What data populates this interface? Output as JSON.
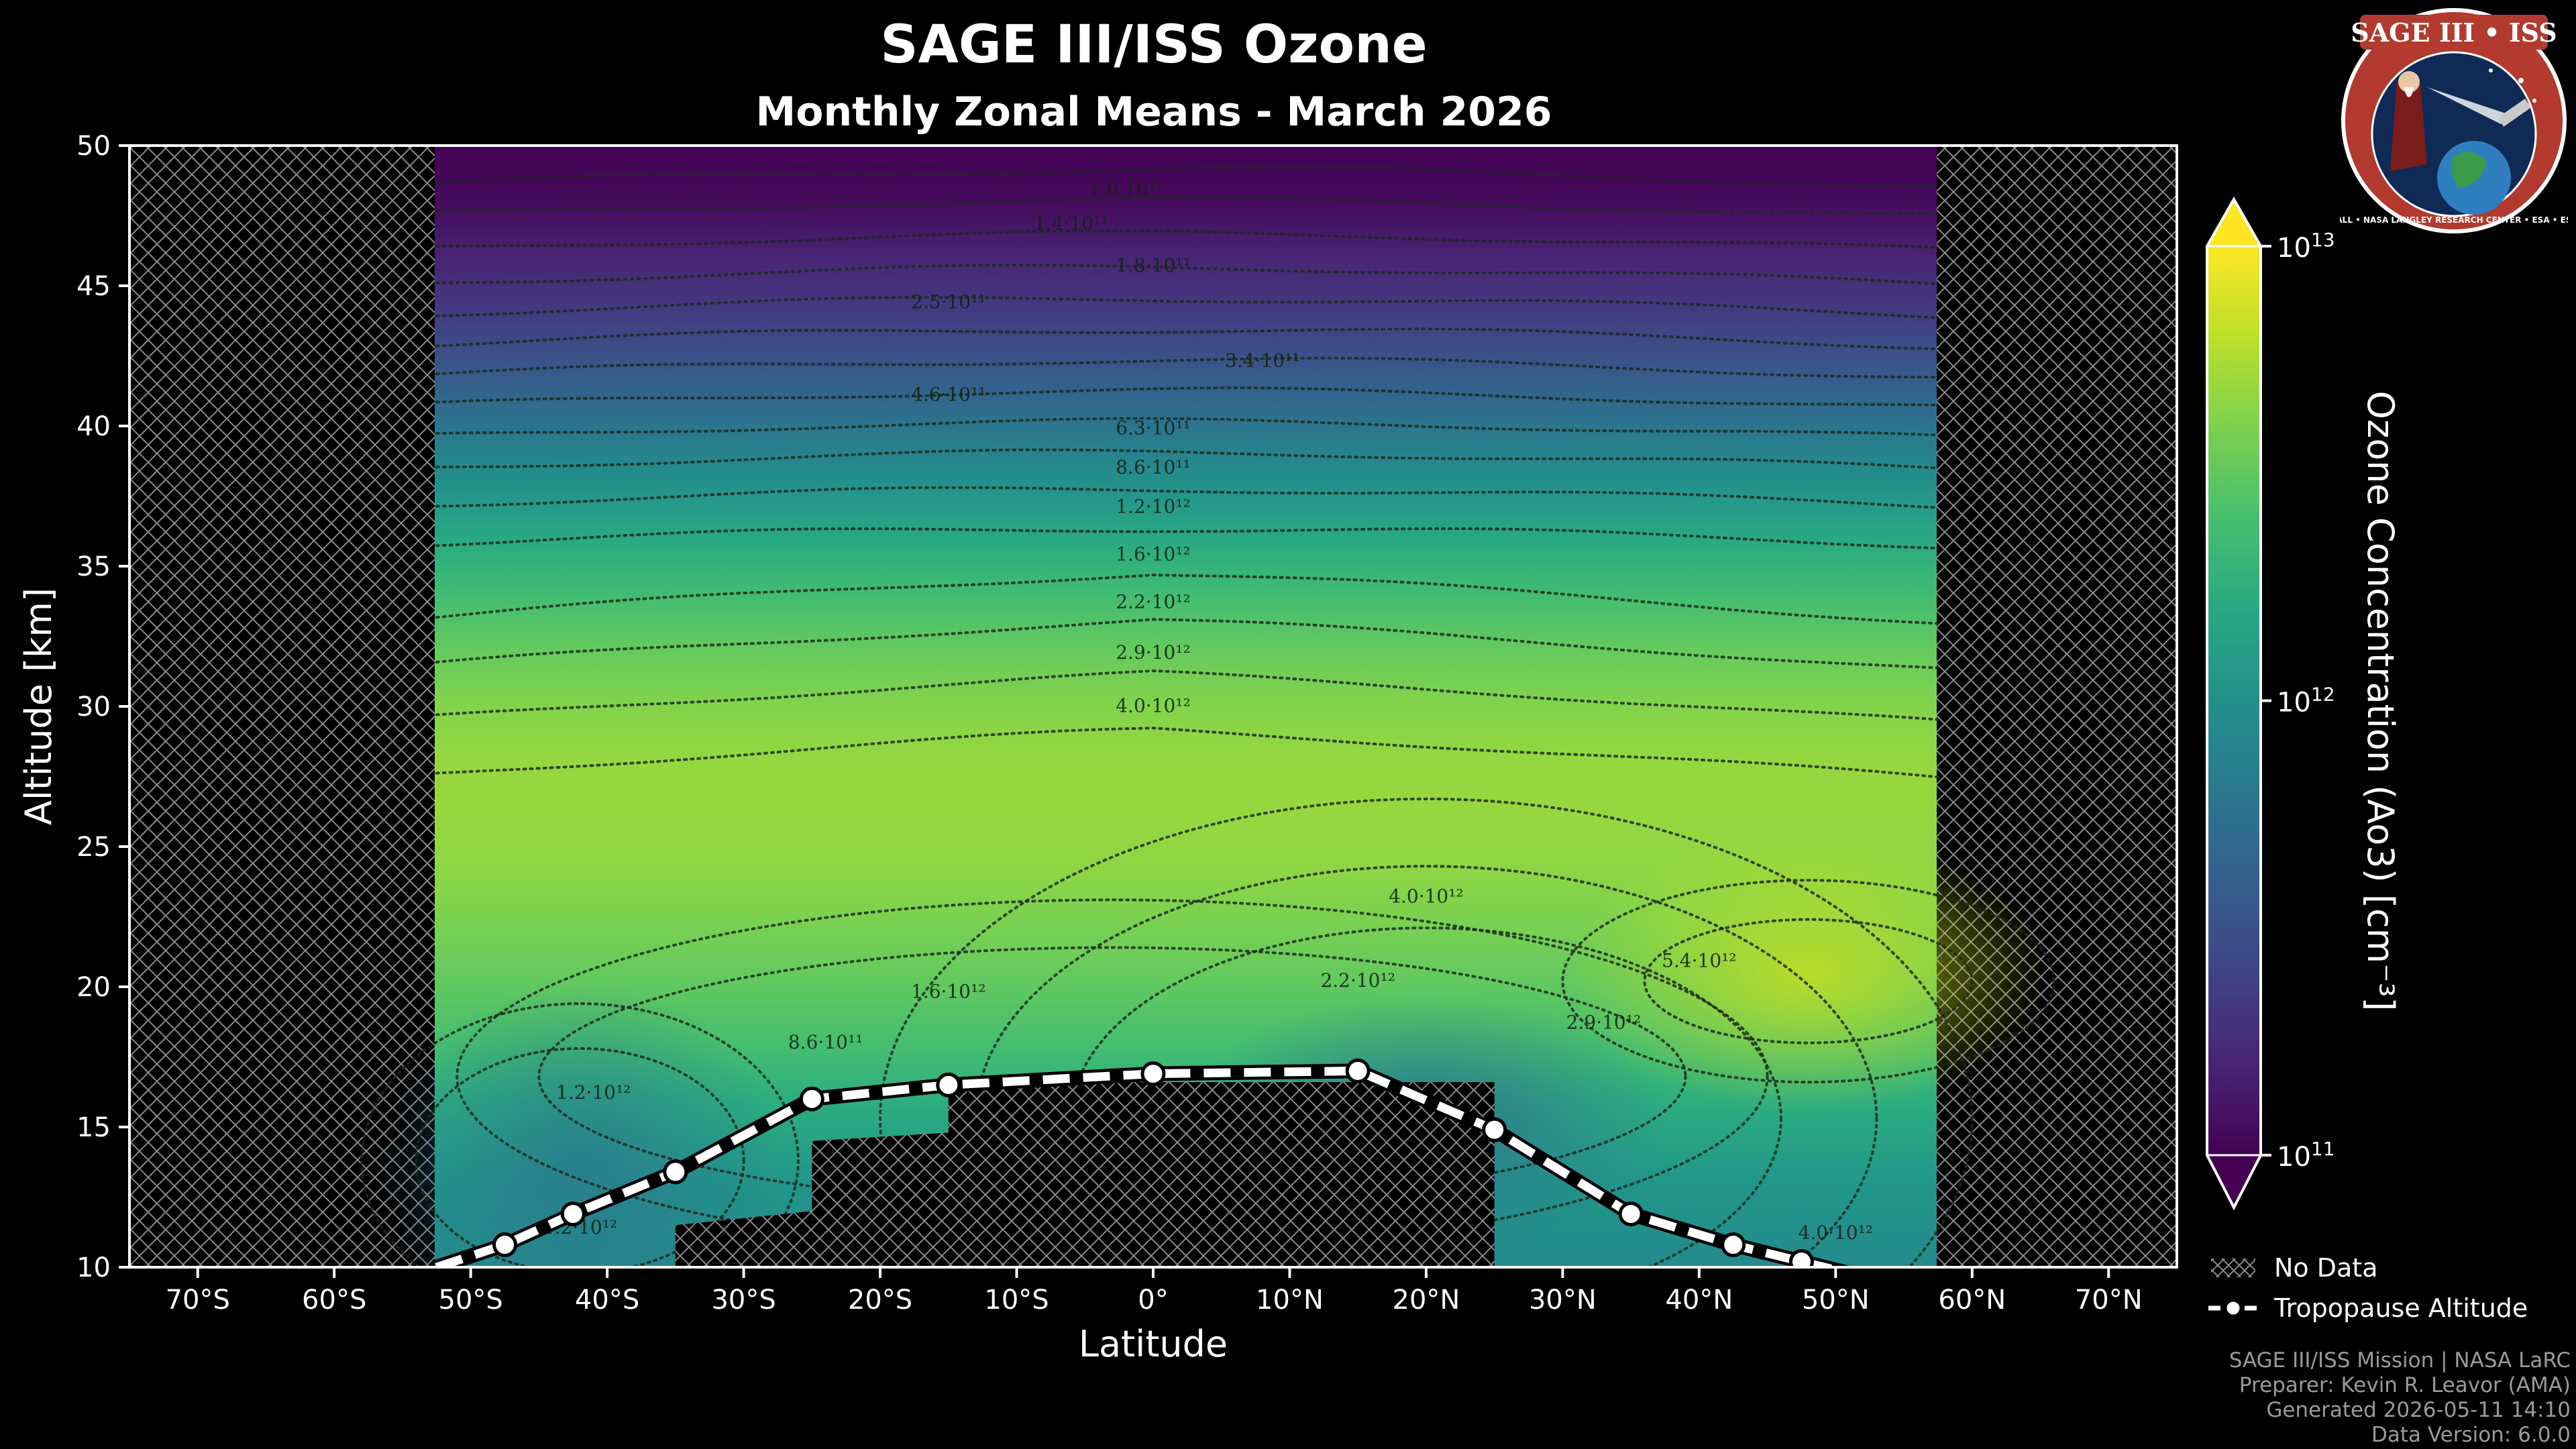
{
  "title": "SAGE III/ISS Ozone",
  "subtitle": "Monthly Zonal Means - March 2026",
  "logo": {
    "top_text": "SAGE III • ISS",
    "ring_text": "BALL • NASA LANGLEY RESEARCH CENTER • ESA • ESA"
  },
  "legend": {
    "no_data": "No Data",
    "tropopause": "Tropopause Altitude"
  },
  "footer": {
    "line1": "SAGE III/ISS Mission | NASA LaRC",
    "line2": "Preparer: Kevin R. Leavor (AMA)",
    "line3": "Generated 2026-05-11 14:10",
    "line4": "Data Version: 6.0.0"
  },
  "colors": {
    "background": "#000000",
    "hatch": "#8a8a8a",
    "contour": "#1c2a1c",
    "tropopause_line": "#ffffff"
  },
  "chart_data": {
    "type": "heatmap",
    "colormap": "viridis",
    "scale": "log",
    "xlabel": "Latitude",
    "ylabel": "Altitude [km]",
    "xlim": [
      -75,
      75
    ],
    "ylim": [
      10,
      50
    ],
    "xticks": [
      -70,
      -60,
      -50,
      -40,
      -30,
      -20,
      -10,
      0,
      10,
      20,
      30,
      40,
      50,
      60,
      70
    ],
    "xtick_labels": [
      "70°S",
      "60°S",
      "50°S",
      "40°S",
      "30°S",
      "20°S",
      "10°S",
      "0°",
      "10°N",
      "20°N",
      "30°N",
      "40°N",
      "50°N",
      "60°N",
      "70°N"
    ],
    "yticks": [
      10,
      15,
      20,
      25,
      30,
      35,
      40,
      45,
      50
    ],
    "colorbar": {
      "label": "Ozone Concentration (Ao3) [cm⁻³]",
      "min": 100000000000.0,
      "max": 10000000000000.0,
      "ticks": [
        {
          "value": 100000000000.0,
          "base": "10",
          "exp": "11"
        },
        {
          "value": 1000000000000.0,
          "base": "10",
          "exp": "12"
        },
        {
          "value": 10000000000000.0,
          "base": "10",
          "exp": "13"
        }
      ],
      "extend": "both"
    },
    "data_extent_lat": [
      -52.5,
      57.5
    ],
    "no_data_below": [
      {
        "lat_from": -35,
        "lat_to": -25,
        "top_km": [
          11.5,
          12.0
        ]
      },
      {
        "lat_from": -25,
        "lat_to": -15,
        "top_km": [
          14.5,
          14.8
        ]
      },
      {
        "lat_from": -15,
        "lat_to": 25,
        "top_km": [
          16.6,
          16.6
        ]
      }
    ],
    "concentration_profile": {
      "altitude_km": [
        10,
        13,
        16,
        18,
        20,
        22,
        24,
        26,
        28,
        30,
        32,
        34,
        36,
        38,
        40,
        42,
        44,
        46,
        48,
        50
      ],
      "log10_cm3": [
        11.95,
        12.05,
        12.25,
        12.4,
        12.5,
        12.58,
        12.65,
        12.68,
        12.68,
        12.62,
        12.52,
        12.38,
        12.2,
        12.0,
        11.78,
        11.55,
        11.35,
        11.2,
        11.05,
        10.95
      ]
    },
    "contour_labels": [
      {
        "text": "1.0·10¹¹",
        "lat": -2,
        "alt": 48.2
      },
      {
        "text": "1.4·10¹¹",
        "lat": -6,
        "alt": 47.0
      },
      {
        "text": "1.8·10¹¹",
        "lat": 0,
        "alt": 45.5
      },
      {
        "text": "2.5·10¹¹",
        "lat": -15,
        "alt": 44.2
      },
      {
        "text": "3.4·10¹¹",
        "lat": 8,
        "alt": 42.1
      },
      {
        "text": "4.6·10¹¹",
        "lat": -15,
        "alt": 40.9
      },
      {
        "text": "6.3·10¹¹",
        "lat": 0,
        "alt": 39.7
      },
      {
        "text": "8.6·10¹¹",
        "lat": 0,
        "alt": 38.3
      },
      {
        "text": "1.2·10¹²",
        "lat": 0,
        "alt": 36.9
      },
      {
        "text": "1.6·10¹²",
        "lat": 0,
        "alt": 35.2
      },
      {
        "text": "2.2·10¹²",
        "lat": 0,
        "alt": 33.5
      },
      {
        "text": "2.9·10¹²",
        "lat": 0,
        "alt": 31.7
      },
      {
        "text": "4.0·10¹²",
        "lat": 0,
        "alt": 29.8
      },
      {
        "text": "4.0·10¹²",
        "lat": 20,
        "alt": 23.0
      },
      {
        "text": "5.4·10¹²",
        "lat": 40,
        "alt": 20.7
      },
      {
        "text": "2.2·10¹²",
        "lat": 15,
        "alt": 20.0
      },
      {
        "text": "2.9·10¹²",
        "lat": 33,
        "alt": 18.5
      },
      {
        "text": "1.6·10¹²",
        "lat": -15,
        "alt": 19.6
      },
      {
        "text": "8.6·10¹¹",
        "lat": -24,
        "alt": 17.8
      },
      {
        "text": "1.2·10¹²",
        "lat": -41,
        "alt": 16.0
      },
      {
        "text": "1.2·10¹²",
        "lat": -42,
        "alt": 11.2
      },
      {
        "text": "4.0·10¹²",
        "lat": 50,
        "alt": 11.0
      }
    ],
    "series": [
      {
        "name": "Tropopause Altitude",
        "lat": [
          -52.5,
          -47.5,
          -42.5,
          -35,
          -25,
          -15,
          0,
          15,
          25,
          35,
          42.5,
          47.5,
          52.5
        ],
        "alt": [
          10.0,
          10.8,
          11.9,
          13.4,
          16.0,
          16.5,
          16.9,
          17.0,
          14.9,
          11.9,
          10.8,
          10.2,
          9.6
        ],
        "markers": [
          -47.5,
          -42.5,
          -35,
          -25,
          -15,
          0,
          15,
          25,
          35,
          42.5,
          47.5
        ]
      }
    ]
  }
}
